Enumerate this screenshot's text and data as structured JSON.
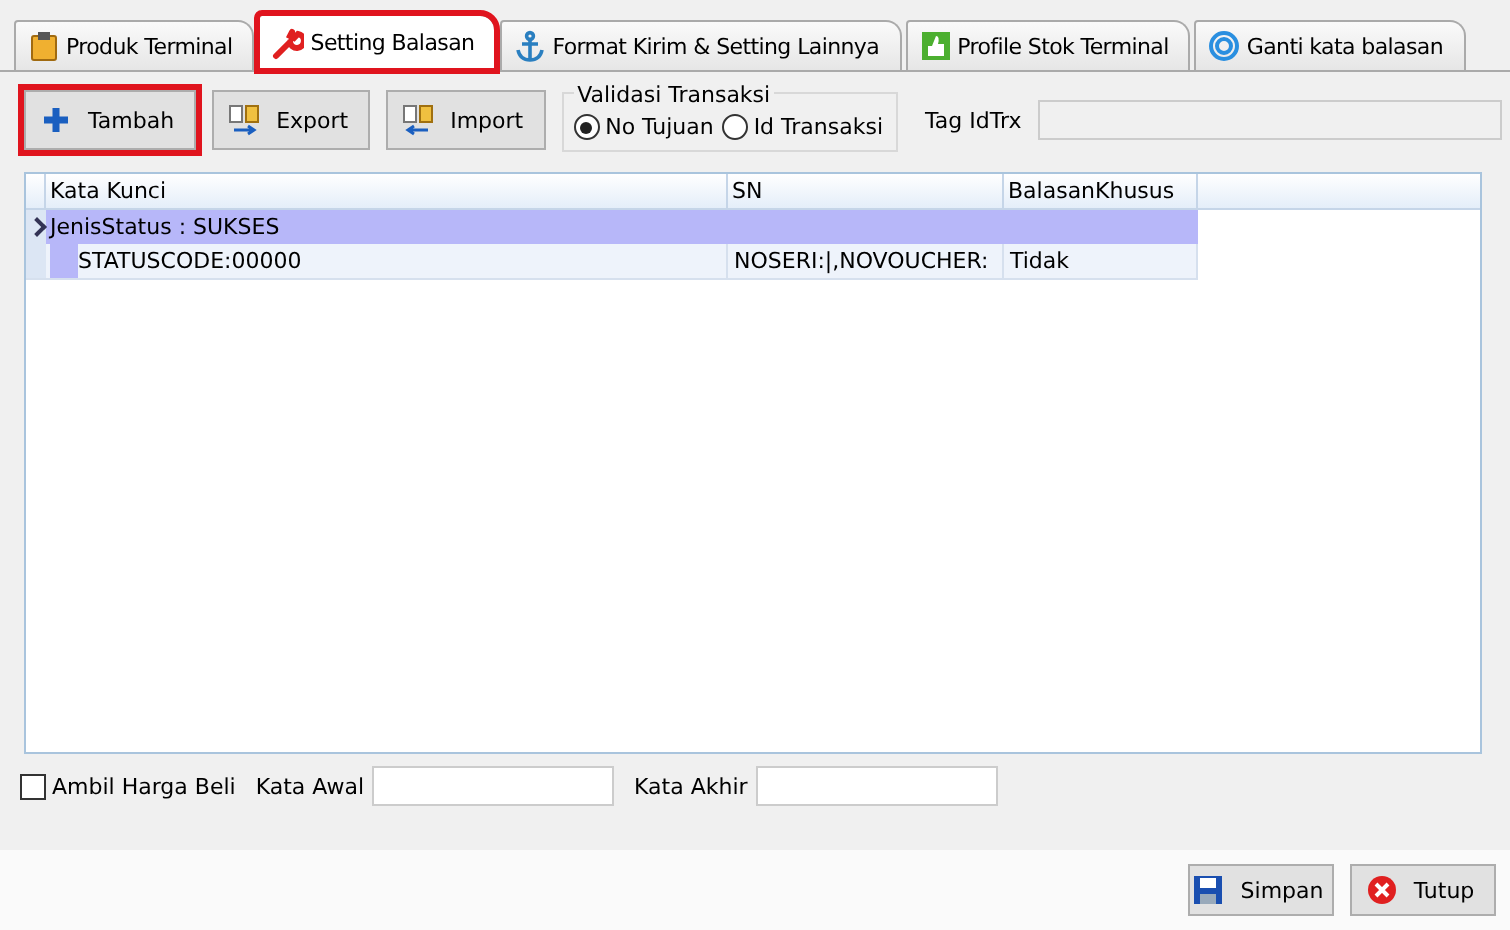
{
  "tabs": [
    {
      "label": "Produk Terminal",
      "selected": false,
      "highlighted": false
    },
    {
      "label": "Setting Balasan",
      "selected": true,
      "highlighted": true
    },
    {
      "label": "Format Kirim & Setting Lainnya",
      "selected": false,
      "highlighted": false
    },
    {
      "label": "Profile Stok Terminal",
      "selected": false,
      "highlighted": false
    },
    {
      "label": "Ganti kata balasan",
      "selected": false,
      "highlighted": false
    }
  ],
  "toolbar": {
    "buttons": [
      {
        "label": "Tambah",
        "highlighted": true
      },
      {
        "label": "Export",
        "highlighted": false
      },
      {
        "label": "Import",
        "highlighted": false
      }
    ],
    "validation": {
      "title": "Validasi Transaksi",
      "options": [
        {
          "label": "No Tujuan",
          "selected": true
        },
        {
          "label": "Id Transaksi",
          "selected": false
        }
      ]
    },
    "tag_label": "Tag IdTrx"
  },
  "table": {
    "columns": [
      "Kata Kunci",
      "SN",
      "BalasanKhusus"
    ],
    "groups": [
      {
        "label": "JenisStatus : SUKSES",
        "rows": [
          [
            "STATUSCODE:00000",
            "NOSERI:|,NOVOUCHER:",
            "Tidak"
          ]
        ]
      }
    ]
  },
  "options": {
    "checkbox": {
      "label": "Ambil Harga Beli",
      "checked": false
    },
    "start_label": "Kata Awal",
    "end_label": "Kata Akhir"
  },
  "footer": {
    "buttons": [
      {
        "label": "Simpan"
      },
      {
        "label": "Tutup"
      }
    ]
  }
}
